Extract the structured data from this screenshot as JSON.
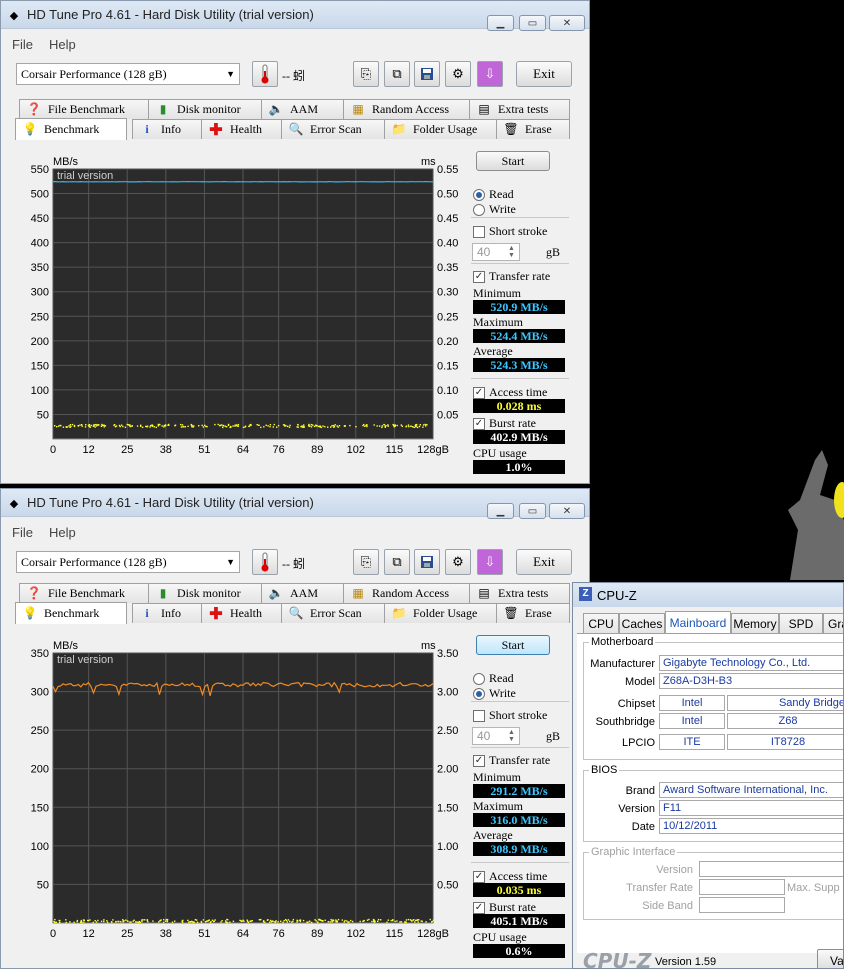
{
  "app": {
    "title": "HD Tune Pro 4.61 - Hard Disk Utility (trial version)",
    "menu": [
      "File",
      "Help"
    ],
    "drive": "Corsair Performance      (128 gB)",
    "temperature": "-- 蚓",
    "exit_label": "Exit",
    "tabs_top": [
      "File Benchmark",
      "Disk monitor",
      "AAM",
      "Random Access",
      "Extra tests"
    ],
    "tabs_bottom": [
      "Benchmark",
      "Info",
      "Health",
      "Error Scan",
      "Folder Usage",
      "Erase"
    ],
    "start_label": "Start",
    "read_label": "Read",
    "write_label": "Write",
    "short_stroke_label": "Short stroke",
    "short_stroke_value": "40",
    "gb_label": "gB",
    "transfer_rate_label": "Transfer rate",
    "minimum_label": "Minimum",
    "maximum_label": "Maximum",
    "average_label": "Average",
    "access_time_label": "Access time",
    "burst_rate_label": "Burst rate",
    "cpu_usage_label": "CPU usage"
  },
  "window1": {
    "mode": "Read",
    "minimum": "520.9 MB/s",
    "maximum": "524.4 MB/s",
    "average": "524.3 MB/s",
    "access_time": "0.028 ms",
    "burst_rate": "402.9 MB/s",
    "cpu_usage": "1.0%"
  },
  "window2": {
    "mode": "Write",
    "minimum": "291.2 MB/s",
    "maximum": "316.0 MB/s",
    "average": "308.9 MB/s",
    "access_time": "0.035 ms",
    "burst_rate": "405.1 MB/s",
    "cpu_usage": "0.6%"
  },
  "chart_data": [
    {
      "type": "line",
      "watermark": "trial version",
      "ylabel": "MB/s",
      "y2label": "ms",
      "xlabel": "gB",
      "ylim": [
        0,
        550
      ],
      "y2lim": [
        0,
        0.55
      ],
      "y_ticks": [
        50,
        100,
        150,
        200,
        250,
        300,
        350,
        400,
        450,
        500,
        550
      ],
      "y2_ticks": [
        "0.05",
        "0.10",
        "0.15",
        "0.20",
        "0.25",
        "0.30",
        "0.35",
        "0.40",
        "0.45",
        "0.50",
        "0.55"
      ],
      "x_ticks": [
        "0",
        "12",
        "25",
        "38",
        "51",
        "64",
        "76",
        "89",
        "102",
        "115",
        "128gB"
      ],
      "xlim": [
        0,
        128
      ],
      "series": [
        {
          "name": "Transfer rate",
          "color": "#3ab3e8",
          "y": 524
        },
        {
          "name": "Access time",
          "color": "#ffff30",
          "y_ms": 0.028
        }
      ]
    },
    {
      "type": "line",
      "watermark": "trial version",
      "ylabel": "MB/s",
      "y2label": "ms",
      "xlabel": "gB",
      "ylim": [
        0,
        350
      ],
      "y2lim": [
        0,
        3.5
      ],
      "y_ticks": [
        50,
        100,
        150,
        200,
        250,
        300,
        350
      ],
      "y2_ticks": [
        "0.50",
        "1.00",
        "1.50",
        "2.00",
        "2.50",
        "3.00",
        "3.50"
      ],
      "x_ticks": [
        "0",
        "12",
        "25",
        "38",
        "51",
        "64",
        "76",
        "89",
        "102",
        "115",
        "128gB"
      ],
      "xlim": [
        0,
        128
      ],
      "series": [
        {
          "name": "Transfer rate",
          "color": "#f08a24",
          "y": 309
        },
        {
          "name": "Access time",
          "color": "#ffff30",
          "y_ms": 0.035
        }
      ]
    }
  ],
  "cpuz": {
    "title": "CPU-Z",
    "tabs": [
      "CPU",
      "Caches",
      "Mainboard",
      "Memory",
      "SPD",
      "Gra"
    ],
    "motherboard_label": "Motherboard",
    "manufacturer_label": "Manufacturer",
    "manufacturer": "Gigabyte Technology Co., Ltd.",
    "model_label": "Model",
    "model": "Z68A-D3H-B3",
    "chipset_label": "Chipset",
    "chipset_vendor": "Intel",
    "chipset_name": "Sandy Bridge",
    "southbridge_label": "Southbridge",
    "southbridge_vendor": "Intel",
    "southbridge_name": "Z68",
    "lpcio_label": "LPCIO",
    "lpcio_vendor": "ITE",
    "lpcio_name": "IT8728",
    "bios_label": "BIOS",
    "brand_label": "Brand",
    "brand": "Award Software International, Inc.",
    "version_label": "Version",
    "version": "F11",
    "date_label": "Date",
    "date": "10/12/2011",
    "graphic_label": "Graphic Interface",
    "gi_version_label": "Version",
    "gi_transfer_label": "Transfer Rate",
    "gi_max_label": "Max. Supp",
    "gi_sideband_label": "Side Band",
    "brand_logo": "CPU-Z",
    "footer_version": "Version 1.59",
    "footer_button": "Va"
  }
}
